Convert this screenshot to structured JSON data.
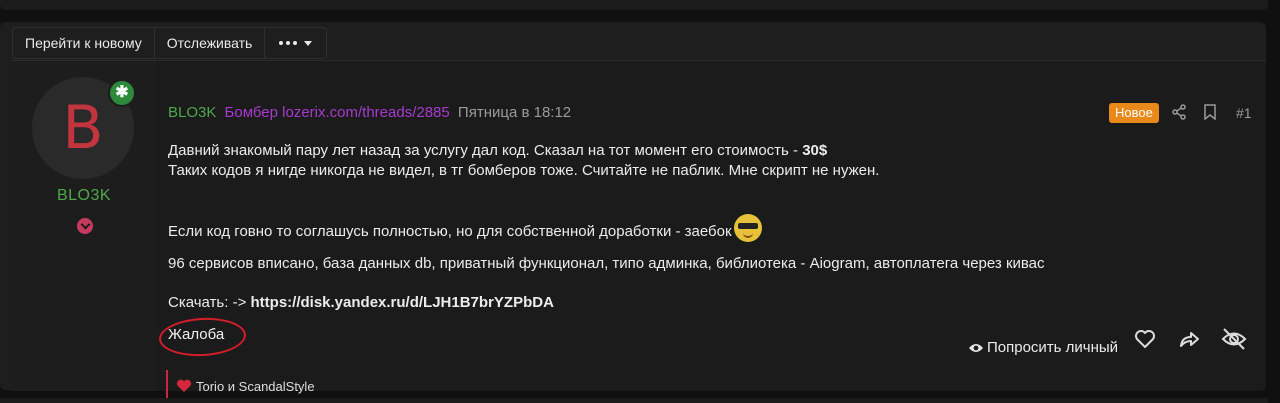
{
  "toolbar": {
    "jump_new": "Перейти к новому",
    "watch": "Отслеживать"
  },
  "user": {
    "avatar_letter": "B",
    "name": "BLO3K"
  },
  "meta": {
    "author": "BLO3K",
    "thread_title": "Бомбер lozerix.com/threads/2885",
    "time": "Пятница в 18:12"
  },
  "header_actions": {
    "new_badge": "Новое",
    "post_number": "#1"
  },
  "body": {
    "line1_prefix": "Давний знакомый пару лет назад за услугу дал код. Сказал на тот момент его стоимость - ",
    "line1_price": "30$",
    "line2": "Таких кодов я нигде никогда не видел, в тг бомберов тоже. Считайте не паблик. Мне скрипт не нужен.",
    "line3": "Если код говно то соглашусь полностью, но для собственной доработки - заебок",
    "line4": "96 сервисов вписано, база данных db, приватный функционал, типо админка, библиотека - Aiogram, автоплатега через кивас",
    "download_label": "Скачать: -> ",
    "download_link": "https://disk.yandex.ru/d/LJH1B7brYZPbDA"
  },
  "footer": {
    "report": "Жалоба",
    "request_private": "Попросить личный"
  },
  "reactions": {
    "text": "Torio и ScandalStyle"
  },
  "colors": {
    "username": "#4fa84a",
    "thread_link": "#a83ad0",
    "new_badge": "#e8891a",
    "avatar_letter": "#c2353f",
    "annotation": "#d61e2a"
  },
  "icons": [
    "more-dots-icon",
    "star-icon",
    "chevron-down-icon",
    "share-icon",
    "bookmark-icon",
    "eye-icon",
    "heart-icon",
    "reply-arrow-icon",
    "eye-off-icon",
    "cool-emoji-icon"
  ]
}
